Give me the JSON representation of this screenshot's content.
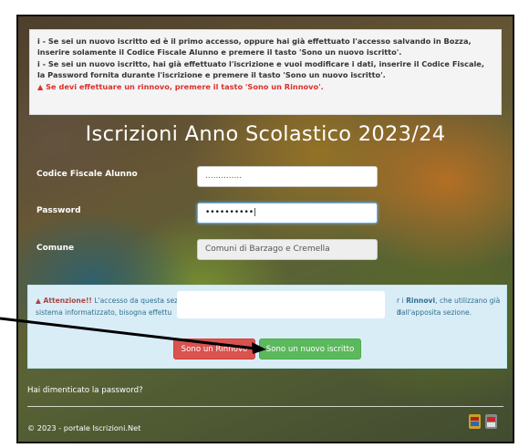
{
  "info": {
    "line1": "i - Se sei un nuovo iscritto ed è il primo accesso, oppure hai già effettuato l'accesso salvando in Bozza, inserire solamente il Codice Fiscale Alunno e premere il tasto 'Sono un nuovo iscritto'.",
    "line2": "i - Se sei un nuovo iscritto, hai già effettuato l'iscrizione e vuoi modificare i dati, inserire il Codice Fiscale, la Password fornita durante l'iscrizione e premere il tasto 'Sono un nuovo iscritto'.",
    "line3": "Se devi effettuare un rinnovo, premere il tasto 'Sono un Rinnovo'."
  },
  "title": "Iscrizioni Anno Scolastico 2023/24",
  "form": {
    "codice_label": "Codice Fiscale Alunno",
    "codice_value": "..............",
    "password_label": "Password",
    "password_value": "••••••••••",
    "comune_label": "Comune",
    "comune_value": "Comuni di Barzago e Cremella"
  },
  "notice": {
    "attention": "Attenzione!!",
    "text_a": "L'accesso da questa sez",
    "rinnovi": "Rinnovi",
    "text_b": ", che utilizzano già il",
    "text_c": "sistema informatizzato, bisogna effettu",
    "text_d": "dall'apposita sezione.",
    "text_e": "r i"
  },
  "buttons": {
    "rinnovo": "Sono un Rinnovo",
    "nuovo": "Sono un nuovo iscritto"
  },
  "footer": {
    "forgot": "Hai dimenticato la password?",
    "copyright": "© 2023 - portale Iscrizioni.Net"
  },
  "colors": {
    "danger": "#d9534f",
    "success": "#5cb85c",
    "info_bg": "#d9edf7",
    "warning_text": "#d9302c"
  }
}
